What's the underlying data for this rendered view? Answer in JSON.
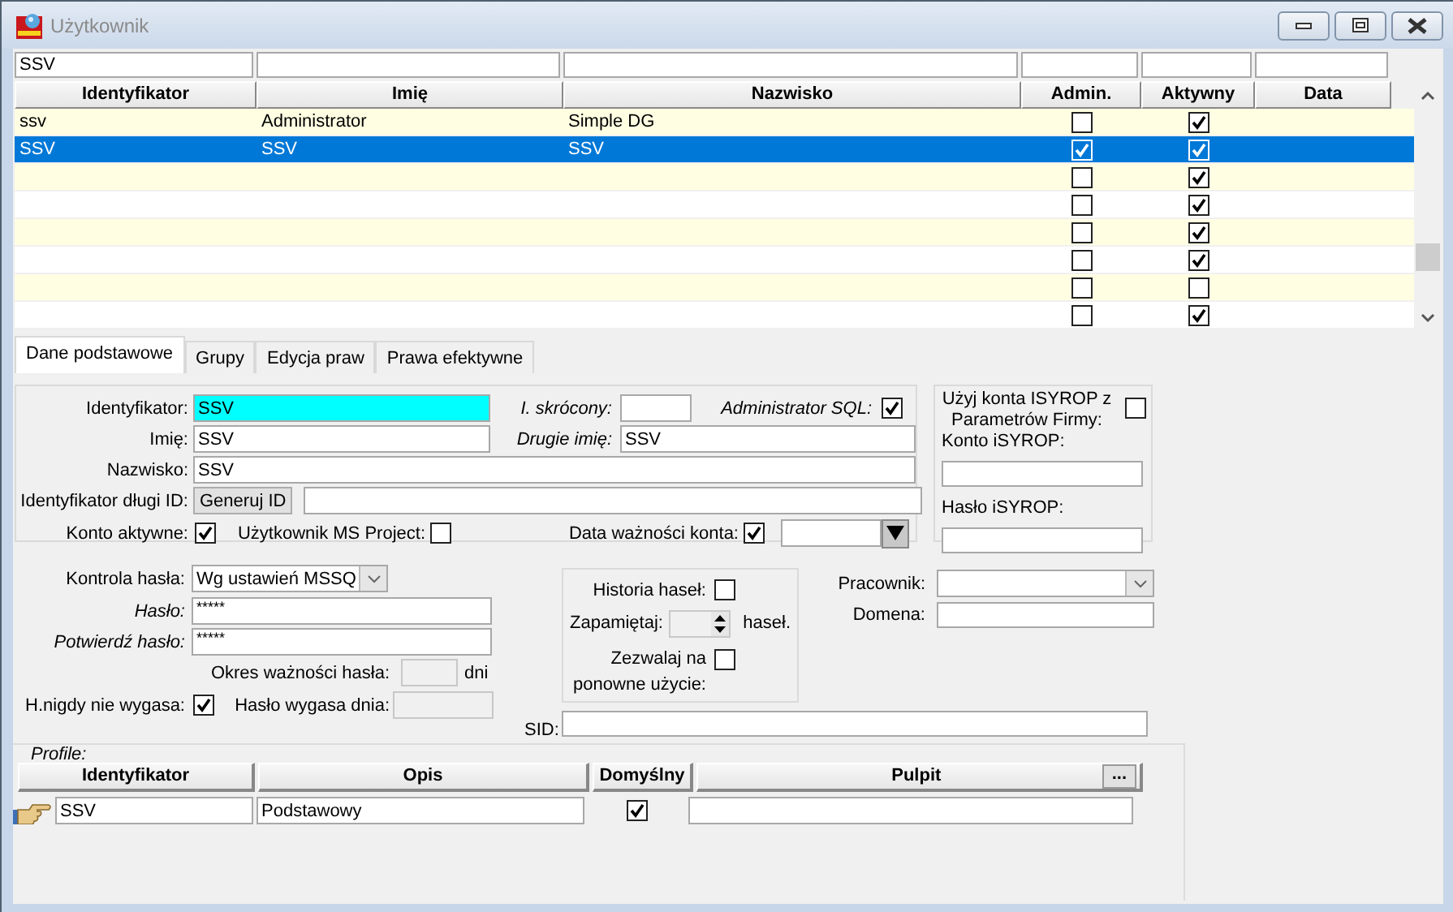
{
  "window": {
    "title": "Użytkownik"
  },
  "grid": {
    "columns": [
      {
        "label": "Identyfikator",
        "kind": "text",
        "filter": "SSV"
      },
      {
        "label": "Imię",
        "kind": "text"
      },
      {
        "label": "Nazwisko",
        "kind": "text"
      },
      {
        "label": "Admin.",
        "kind": "check"
      },
      {
        "label": "Aktywny",
        "kind": "check"
      },
      {
        "label": "Data",
        "kind": "text"
      }
    ],
    "rows": [
      {
        "identyfikator": "ssv",
        "imie": "Administrator",
        "nazwisko": "Simple DG",
        "admin": false,
        "aktywny": true,
        "selected": false
      },
      {
        "identyfikator": "SSV",
        "imie": "SSV",
        "nazwisko": "SSV",
        "admin": true,
        "aktywny": true,
        "selected": true
      },
      {
        "admin": false,
        "aktywny": true,
        "selected": false
      },
      {
        "admin": false,
        "aktywny": true,
        "selected": false
      },
      {
        "admin": false,
        "aktywny": true,
        "selected": false
      },
      {
        "admin": false,
        "aktywny": true,
        "selected": false
      },
      {
        "admin": false,
        "aktywny": false,
        "selected": false
      },
      {
        "admin": false,
        "aktywny": true,
        "selected": false
      }
    ]
  },
  "tabs": [
    {
      "label": "Dane podstawowe",
      "selected": true
    },
    {
      "label": "Grupy",
      "selected": false
    },
    {
      "label": "Edycja praw",
      "selected": false
    },
    {
      "label": "Prawa efektywne",
      "selected": false
    }
  ],
  "form": {
    "identyfikator": {
      "label": "Identyfikator:",
      "value": "SSV"
    },
    "skrocony": {
      "label": "I. skrócony:",
      "italic": true
    },
    "admin_sql": {
      "label": "Administrator SQL:",
      "italic": true,
      "checked": true
    },
    "imie": {
      "label": "Imię:",
      "value": "SSV"
    },
    "drugie_imie": {
      "label": "Drugie imię:",
      "italic": true,
      "value": "SSV"
    },
    "nazwisko": {
      "label": "Nazwisko:",
      "value": "SSV"
    },
    "dlugi_id": {
      "label": "Identyfikator długi ID:",
      "button": "Generuj ID"
    },
    "konto_aktywne": {
      "label": "Konto aktywne:",
      "checked": true
    },
    "ms_project": {
      "label": "Użytkownik MS Project:",
      "checked": false
    },
    "data_waznosci": {
      "label": "Data ważności konta:",
      "checked": true
    },
    "isyrop": {
      "label": "Użyj konta ISYROP z Parametrów Firmy:",
      "checked": false,
      "konto_label": "Konto iSYROP:",
      "haslo_label": "Hasło iSYROP:"
    },
    "kontrola": {
      "label": "Kontrola hasła:",
      "value": "Wg ustawień MSSQ"
    },
    "haslo": {
      "label": "Hasło:",
      "italic": true,
      "value": "*****"
    },
    "potwierdz": {
      "label": "Potwierdź hasło:",
      "italic": true,
      "value": "*****"
    },
    "okres": {
      "label": "Okres ważności hasła:",
      "unit": "dni"
    },
    "nigdy": {
      "label": "H.nigdy nie wygasa:",
      "checked": true
    },
    "wygasa": {
      "label": "Hasło wygasa dnia:"
    },
    "historia": {
      "label": "Historia haseł:",
      "checked": false
    },
    "zapamietaj": {
      "label": "Zapamiętaj:",
      "unit": "haseł."
    },
    "zezwalaj": {
      "label": "Zezwalaj na ponowne użycie:",
      "checked": false
    },
    "pracownik": {
      "label": "Pracownik:"
    },
    "domena": {
      "label": "Domena:"
    },
    "sid": {
      "label": "SID:"
    }
  },
  "profiles": {
    "title": "Profile:",
    "columns": [
      "Identyfikator",
      "Opis",
      "Domyślny",
      "Pulpit"
    ],
    "more_button": "...",
    "rows": [
      {
        "identyfikator": "SSV",
        "opis": "Podstawowy",
        "domyslny": true
      }
    ]
  }
}
